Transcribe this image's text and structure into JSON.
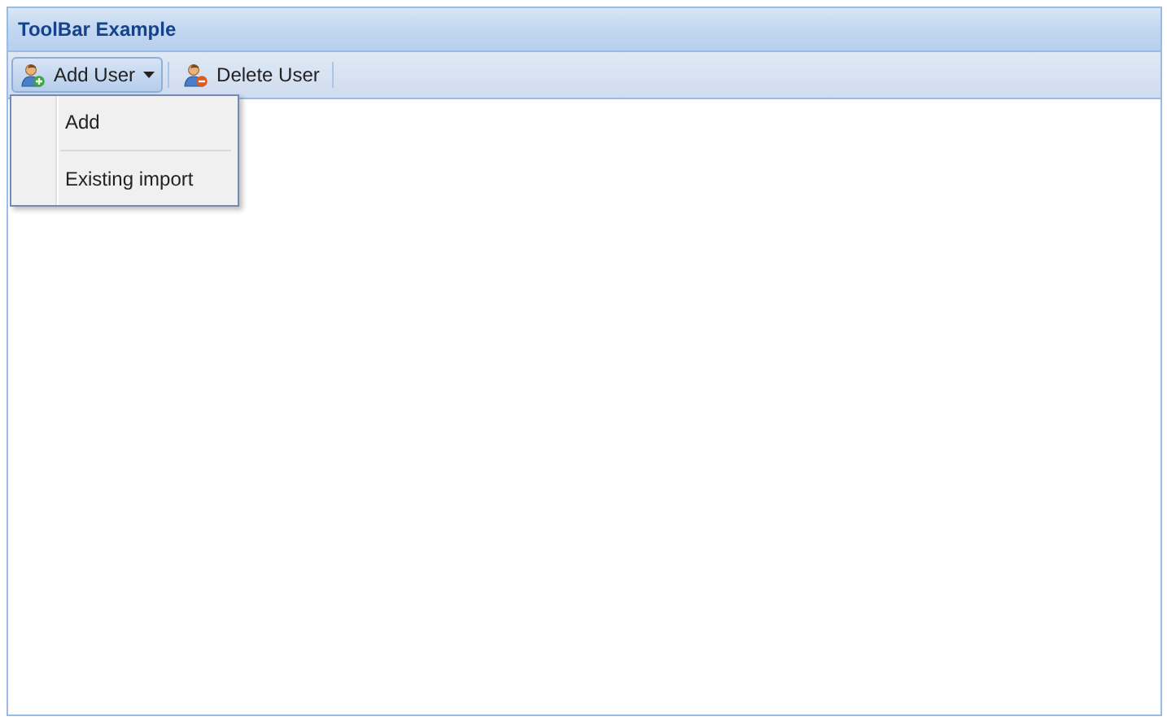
{
  "panel": {
    "title": "ToolBar Example"
  },
  "toolbar": {
    "buttons": [
      {
        "label": "Add User",
        "kind": "add",
        "selected": true,
        "has_menu": true
      },
      {
        "label": "Delete User",
        "kind": "delete",
        "selected": false,
        "has_menu": false
      }
    ]
  },
  "menu": {
    "items": [
      {
        "label": "Add"
      },
      {
        "label": "Existing import"
      }
    ]
  }
}
